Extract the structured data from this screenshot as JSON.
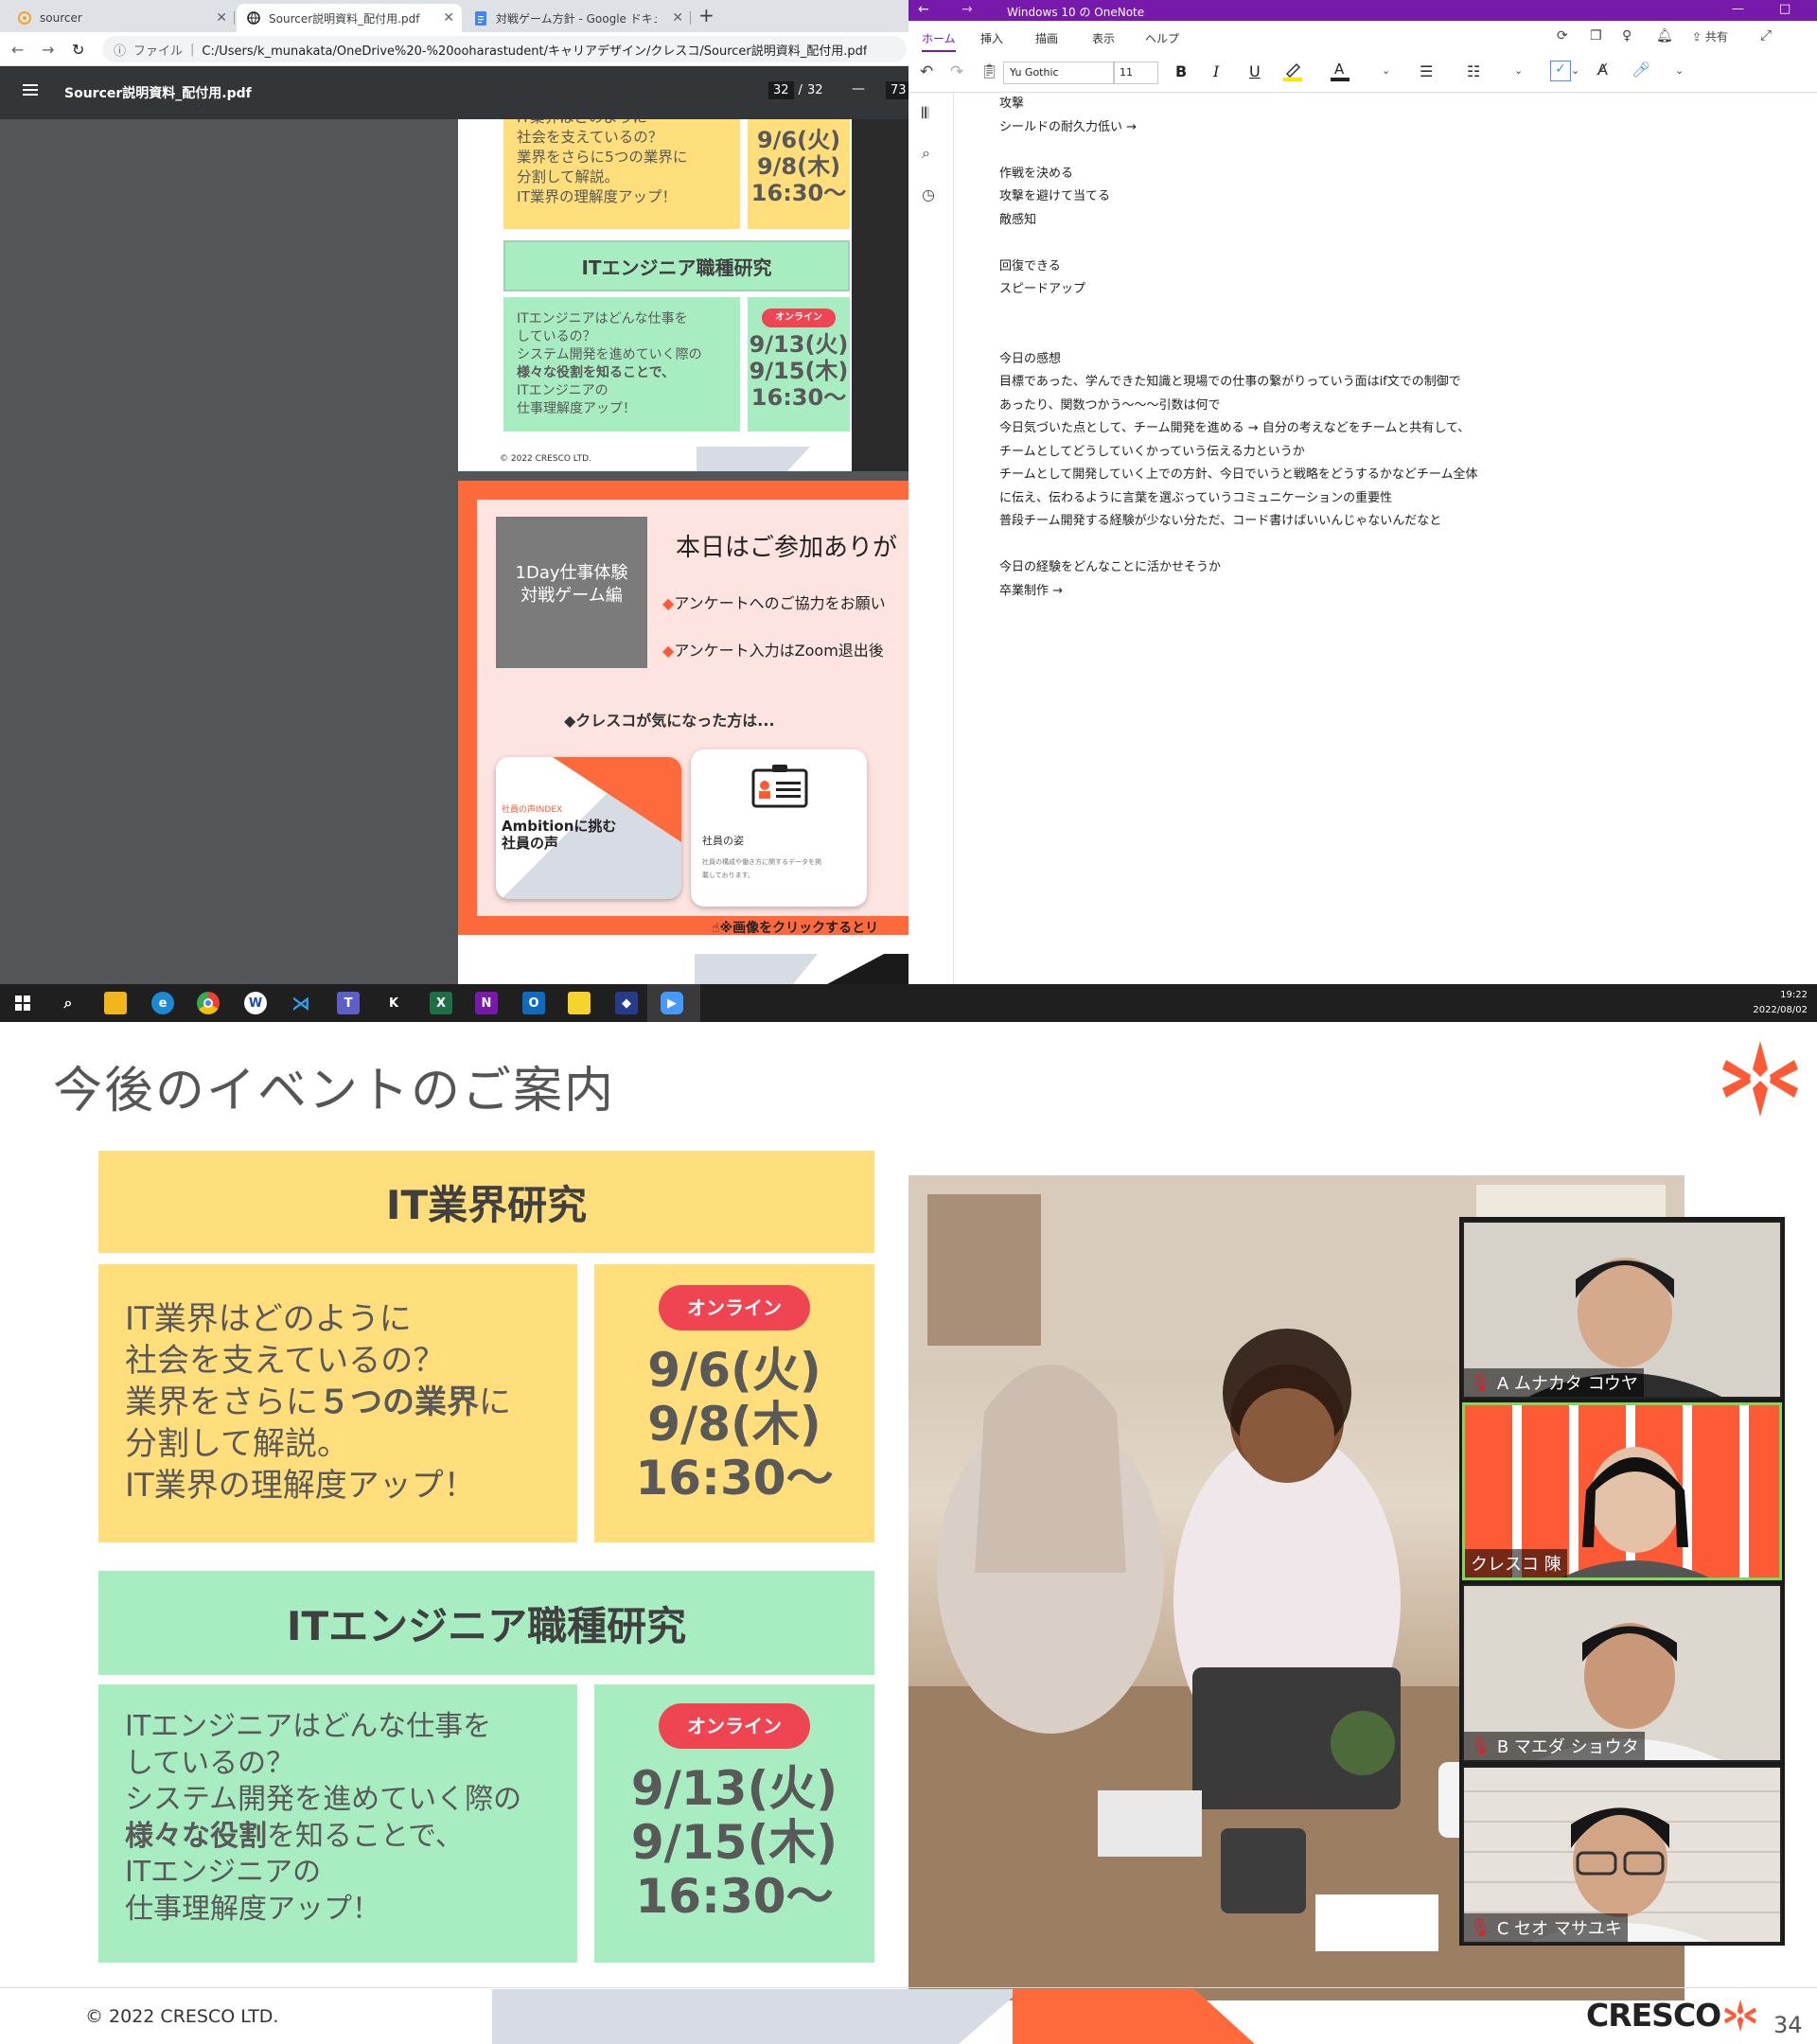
{
  "browser": {
    "tabs": [
      {
        "title": "sourcer",
        "icon": "sourcer-icon"
      },
      {
        "title": "Sourcer説明資料_配付用.pdf",
        "icon": "globe-icon"
      },
      {
        "title": "対戦ゲーム方針 - Google ドキュメン",
        "icon": "google-docs-icon"
      }
    ],
    "new_tab": "+",
    "address_prefix": "ファイル",
    "address": "C:/Users/k_munakata/OneDrive%20-%20ooharastudent/キャリアデザイン/クレスコ/Sourcer説明資料_配付用.pdf"
  },
  "pdf": {
    "filename": "Sourcer説明資料_配付用.pdf",
    "page_current": "32",
    "page_sep": "/",
    "page_total": "32",
    "zoom_minus": "—",
    "zoom": "73",
    "page1": {
      "it_desc": [
        "IT業界はどのように",
        "社会を支えているの？",
        "業界をさらに5つの業界に",
        "分割して解説。",
        "IT業界の理解度アップ！"
      ],
      "it_dates": [
        "9/6(火)",
        "9/8(木)",
        "16:30〜"
      ],
      "eng_title": "ITエンジニア職種研究",
      "eng_badge": "オンライン",
      "eng_desc": [
        "ITエンジニアはどんな仕事を",
        "しているの？",
        "システム開発を進めていく際の",
        "様々な役割を知ることで、",
        "ITエンジニアの",
        "仕事理解度アップ！"
      ],
      "eng_dates": [
        "9/13(火)",
        "9/15(木)",
        "16:30〜"
      ],
      "copyright": "© 2022 CRESCO LTD."
    },
    "page2": {
      "event_line1": "1Day仕事体験",
      "event_line2": "対戦ゲーム編",
      "thanks": "本日はご参加ありが",
      "bullet1": "アンケートへのご協力をお願い",
      "bullet2": "アンケート入力はZoom退出後",
      "interest": "◆クレスコが気になった方は...",
      "card1_tag": "社員の声INDEX",
      "card1_title1": "Ambitionに挑む",
      "card1_title2": "社員の声",
      "card2_title": "社員の姿",
      "card2_desc1": "社員の構成や働き方に関するデータを掲",
      "card2_desc2": "載しております。",
      "click_note": "※画像をクリックするとリ"
    }
  },
  "onenote": {
    "title": "Windows 10 の OneNote",
    "menu": [
      "ホーム",
      "挿入",
      "描画",
      "表示",
      "ヘルプ"
    ],
    "share": "共有",
    "font": "Yu Gothic",
    "font_size": "11",
    "lines": [
      "攻撃",
      "シールドの耐久力低い →",
      "",
      "作戦を決める",
      "攻撃を避けて当てる",
      "敵感知",
      "",
      "回復できる",
      "スピードアップ",
      "",
      "",
      "今日の感想",
      "目標であった、学んできた知識と現場での仕事の繋がりっていう面はif文での制御で",
      "あったり、関数つかう〜〜〜引数は何で",
      "今日気づいた点として、チーム開発を進める → 自分の考えなどをチームと共有して、",
      "チームとしてどうしていくかっていう伝える力というか",
      "チームとして開発していく上での方針、今日でいうと戦略をどうするかなどチーム全体",
      "に伝え、伝わるように言葉を選ぶっていうコミュニケーションの重要性",
      "普段チーム開発する経験が少ない分ただ、コード書けばいいんじゃないんだなと",
      "",
      "今日の経験をどんなことに活かせそうか",
      "卒業制作 →"
    ]
  },
  "taskbar": {
    "time": "19:22",
    "date": "2022/08/02",
    "apps": [
      "start-icon",
      "search-icon",
      "file-explorer-icon",
      "edge-icon",
      "chrome-icon",
      "word-icon",
      "vscode-icon",
      "teams-icon",
      "kindle-icon",
      "excel-icon",
      "onenote-icon",
      "outlook-icon",
      "sticky-notes-icon",
      "app-icon",
      "zoom-icon"
    ]
  },
  "slide": {
    "title": "今後のイベントのご案内",
    "it_title": "IT業界研究",
    "badge": "オンライン",
    "it_desc": [
      {
        "pre": "IT業界はどのように",
        "bold": "",
        "post": ""
      },
      {
        "pre": "社会を支えているの？",
        "bold": "",
        "post": ""
      },
      {
        "pre": "業界をさらに",
        "bold": "５つの業界",
        "post": "に"
      },
      {
        "pre": "分割して解説。",
        "bold": "",
        "post": ""
      },
      {
        "pre": "IT業界の理解度アップ！",
        "bold": "",
        "post": ""
      }
    ],
    "it_dates": [
      "9/6(火)",
      "9/8(木)",
      "16:30〜"
    ],
    "eng_title": "ITエンジニア職種研究",
    "eng_desc": [
      {
        "pre": "ITエンジニアはどんな仕事を",
        "bold": "",
        "post": ""
      },
      {
        "pre": "しているの？",
        "bold": "",
        "post": ""
      },
      {
        "pre": "システム開発を進めていく際の",
        "bold": "",
        "post": ""
      },
      {
        "pre": "",
        "bold": "様々な役割",
        "post": "を知ることで、"
      },
      {
        "pre": "ITエンジニアの",
        "bold": "",
        "post": ""
      },
      {
        "pre": "仕事理解度アップ！",
        "bold": "",
        "post": ""
      }
    ],
    "eng_dates": [
      "9/13(火)",
      "9/15(木)",
      "16:30〜"
    ],
    "copyright": "© 2022 CRESCO LTD.",
    "brand": "CRESCO",
    "page_number": "34",
    "colors": {
      "yellow": "#ffde7b",
      "green": "#a8ecc1",
      "badge": "#ef4552",
      "accent": "#ff5a36"
    }
  },
  "zoom": {
    "participants": [
      {
        "name": "A ムナカタ コウヤ",
        "muted": true
      },
      {
        "name": "クレスコ 陳",
        "muted": false
      },
      {
        "name": "B マエダ ショウタ",
        "muted": true
      },
      {
        "name": "C セオ マサユキ",
        "muted": true
      }
    ]
  }
}
